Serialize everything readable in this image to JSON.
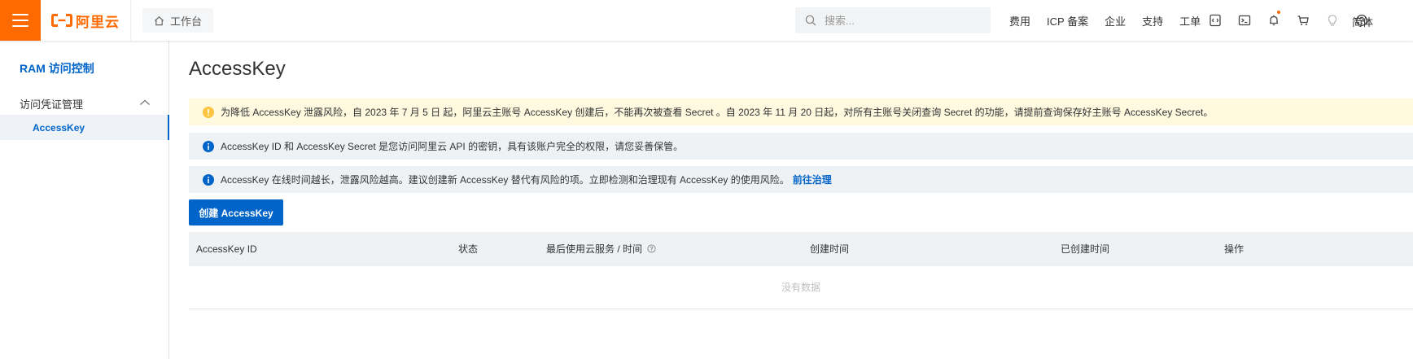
{
  "header": {
    "logo_text": "阿里云",
    "workbench_label": "工作台",
    "search_placeholder": "搜索...",
    "nav_links": [
      "费用",
      "ICP 备案",
      "企业",
      "支持",
      "工单"
    ],
    "language": "简体",
    "accent_color": "#ff6a00"
  },
  "sidebar": {
    "title": "RAM 访问控制",
    "group_label": "访问凭证管理",
    "active_item": "AccessKey",
    "link_color": "#0064c8"
  },
  "main": {
    "page_title": "AccessKey",
    "alerts": {
      "warning": "为降低 AccessKey 泄露风险，自 2023 年 7 月 5 日 起，阿里云主账号 AccessKey 创建后，不能再次被查看 Secret 。自 2023 年 11 月 20 日起，对所有主账号关闭查询 Secret 的功能，请提前查询保存好主账号 AccessKey Secret。",
      "info1": "AccessKey ID 和 AccessKey Secret 是您访问阿里云 API 的密钥，具有该账户完全的权限，请您妥善保管。",
      "info2": "AccessKey 在线时间越长，泄露风险越高。建议创建新 AccessKey 替代有风险的项。立即检测和治理现有 AccessKey 的使用风险。",
      "info2_link": "前往治理"
    },
    "create_button": "创建 AccessKey",
    "table": {
      "columns": [
        "AccessKey ID",
        "状态",
        "最后使用云服务 / 时间",
        "创建时间",
        "已创建时间",
        "操作"
      ],
      "empty_text": "没有数据"
    }
  },
  "icons": {
    "menu": "hamburger-icon",
    "home": "home-icon",
    "search": "search-icon",
    "toolbar": [
      "code-icon",
      "terminal-icon",
      "bell-icon",
      "cart-icon",
      "lightbulb-icon",
      "help-icon"
    ],
    "warning": "warning-icon",
    "info": "info-icon",
    "sidebar_collapse": "chevron-up-icon"
  }
}
